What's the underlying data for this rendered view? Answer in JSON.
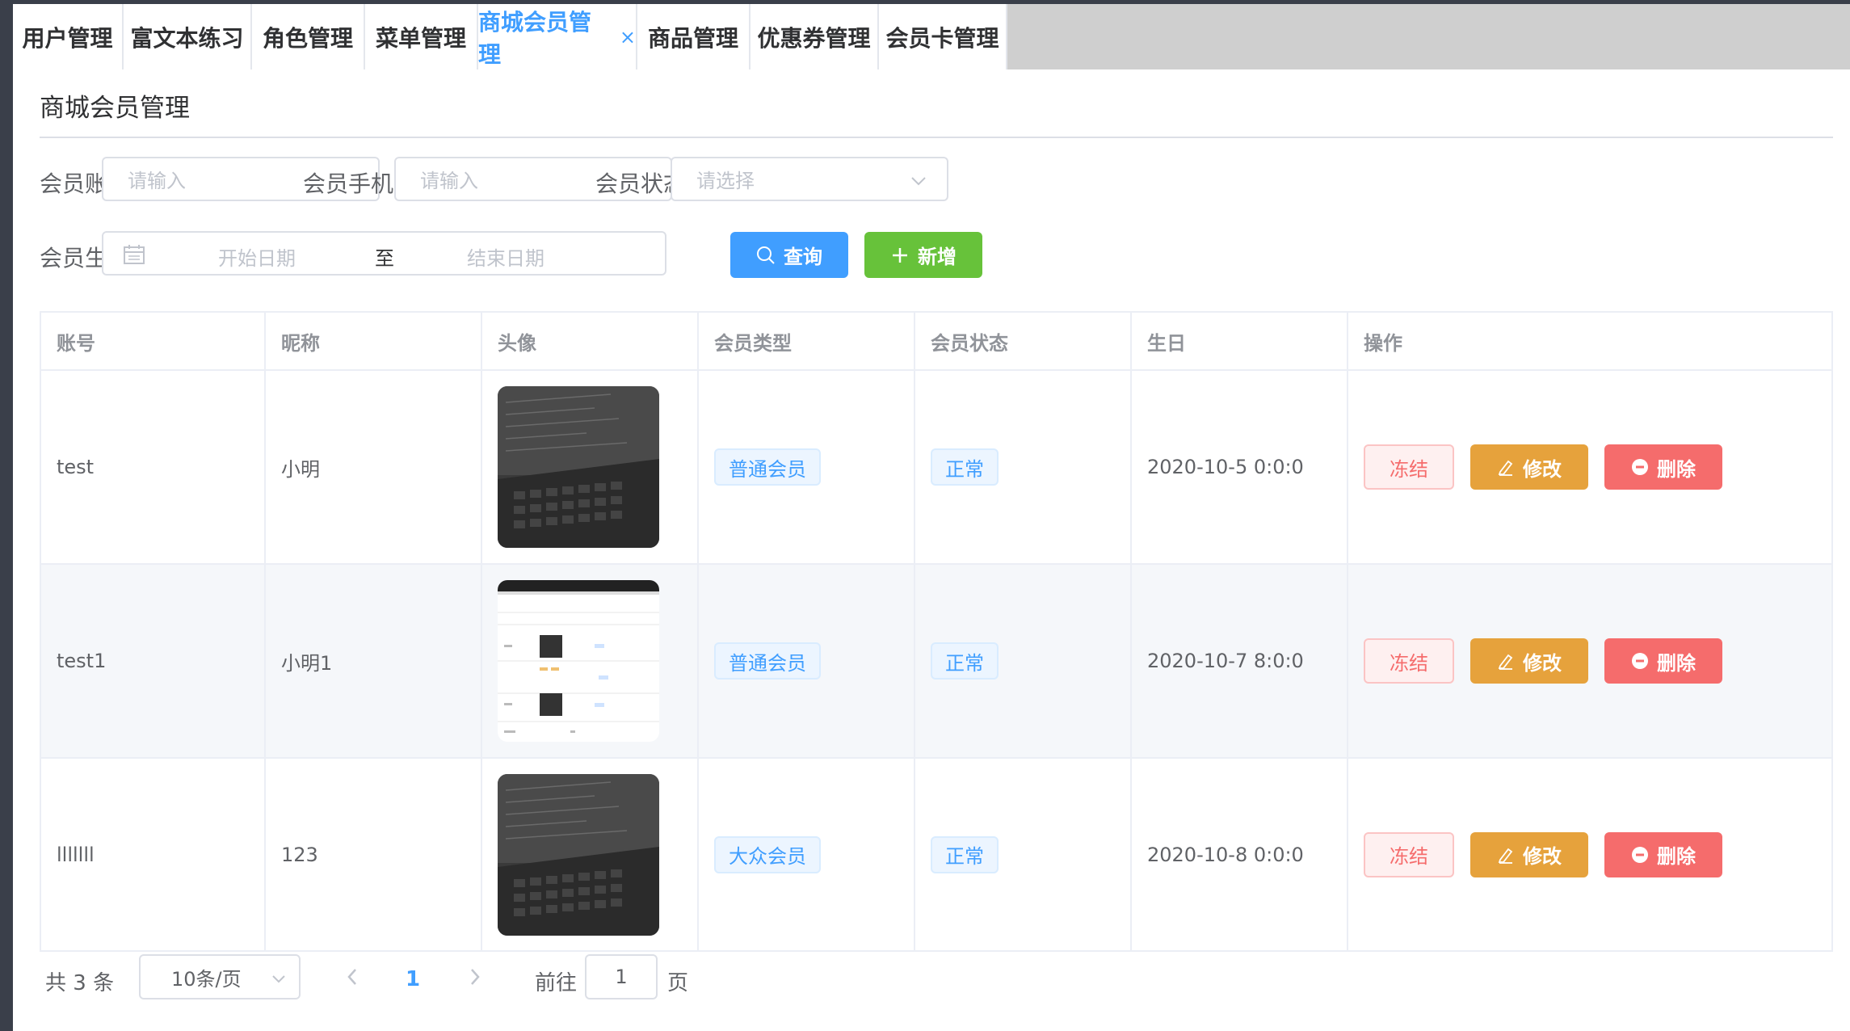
{
  "tabs": [
    {
      "label": "用户管理"
    },
    {
      "label": "富文本练习"
    },
    {
      "label": "角色管理"
    },
    {
      "label": "菜单管理"
    },
    {
      "label": "商城会员管理",
      "active": true
    },
    {
      "label": "商品管理"
    },
    {
      "label": "优惠券管理"
    },
    {
      "label": "会员卡管理"
    }
  ],
  "tab_close": "×",
  "page": {
    "title": "商城会员管理"
  },
  "search": {
    "account_label": "会员账号",
    "account_placeholder": "请输入",
    "phone_label": "会员手机号",
    "phone_placeholder": "请输入",
    "status_label": "会员状态",
    "status_placeholder": "请选择",
    "birthday_label": "会员生日",
    "start_placeholder": "开始日期",
    "range_sep": "至",
    "end_placeholder": "结束日期",
    "query_label": "查询",
    "add_label": "新增"
  },
  "table": {
    "headers": [
      "账号",
      "昵称",
      "头像",
      "会员类型",
      "会员状态",
      "生日",
      "操作"
    ],
    "rows": [
      {
        "account": "test",
        "nickname": "小明",
        "avatar": "laptop-photo",
        "type": "普通会员",
        "status": "正常",
        "birthday": "2020-10-5 0:0:0"
      },
      {
        "account": "test1",
        "nickname": "小明1",
        "avatar": "screenshot-thumbnail",
        "type": "普通会员",
        "status": "正常",
        "birthday": "2020-10-7 8:0:0"
      },
      {
        "account": "lllllll",
        "nickname": "123",
        "avatar": "laptop-photo",
        "type": "大众会员",
        "status": "正常",
        "birthday": "2020-10-8 0:0:0"
      }
    ],
    "actions": {
      "freeze": "冻结",
      "edit": "修改",
      "delete": "删除"
    }
  },
  "pagination": {
    "total_text": "共 3 条",
    "page_size": "10条/页",
    "current_page": "1",
    "goto_label": "前往",
    "goto_value": "1",
    "page_unit": "页"
  },
  "colors": {
    "primary": "#409eff",
    "success": "#67c23a",
    "warning": "#e6a23c",
    "danger": "#f56c6c"
  }
}
